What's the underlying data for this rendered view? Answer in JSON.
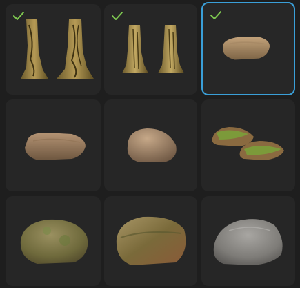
{
  "assets": {
    "colors": {
      "background": "#1e1e1e",
      "tile": "#262626",
      "selection_border": "#3a9fd8",
      "checkmark": "#7ec850"
    },
    "tiles": [
      {
        "id": "tree-trunk-twisted",
        "checked": true,
        "selected": false,
        "thumbnail": "tree-trunk-pair-icon"
      },
      {
        "id": "tree-trunk-rooted",
        "checked": true,
        "selected": false,
        "thumbnail": "tree-trunk-pair-icon"
      },
      {
        "id": "flat-rock-small",
        "checked": true,
        "selected": true,
        "thumbnail": "flat-rock-icon"
      },
      {
        "id": "flat-slab-rock",
        "checked": false,
        "selected": false,
        "thumbnail": "flat-rock-icon"
      },
      {
        "id": "round-boulder",
        "checked": false,
        "selected": false,
        "thumbnail": "boulder-icon"
      },
      {
        "id": "mossy-rock-pair",
        "checked": false,
        "selected": false,
        "thumbnail": "mossy-rock-icon"
      },
      {
        "id": "mossy-boulder-round",
        "checked": false,
        "selected": false,
        "thumbnail": "mossy-boulder-icon"
      },
      {
        "id": "mossy-boulder-angular",
        "checked": false,
        "selected": false,
        "thumbnail": "mossy-boulder-icon"
      },
      {
        "id": "grey-granite-boulder",
        "checked": false,
        "selected": false,
        "thumbnail": "granite-boulder-icon"
      }
    ]
  }
}
